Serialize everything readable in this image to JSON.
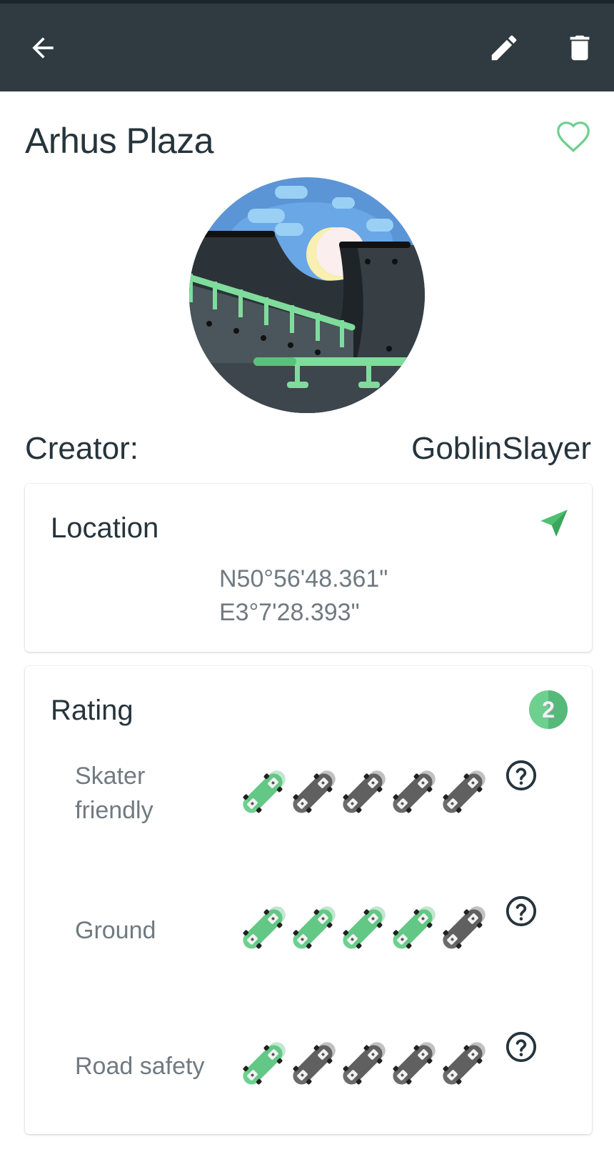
{
  "appbar": {
    "back_icon": "arrow-left-icon",
    "edit_icon": "pencil-icon",
    "delete_icon": "trash-icon",
    "background": "#2f3b41"
  },
  "spot": {
    "title": "Arhus Plaza",
    "favorite_icon": "heart-outline-icon",
    "image_icon": "skatepark-illustration"
  },
  "creator": {
    "label": "Creator:",
    "value": "GoblinSlayer"
  },
  "location": {
    "heading": "Location",
    "navigate_icon": "navigation-arrow-icon",
    "latitude": "N50°56'48.361\"",
    "longitude": "E3°7'28.393\""
  },
  "rating": {
    "heading": "Rating",
    "badge_count": "2",
    "max": 5,
    "categories": [
      {
        "label": "Skater friendly",
        "value": 1
      },
      {
        "label": "Ground",
        "value": 4
      },
      {
        "label": "Road safety",
        "value": 1
      }
    ]
  },
  "colors": {
    "accent_green": "#6ed08f",
    "inactive_gray": "#6b6b6b",
    "text_dark": "#26343c"
  }
}
